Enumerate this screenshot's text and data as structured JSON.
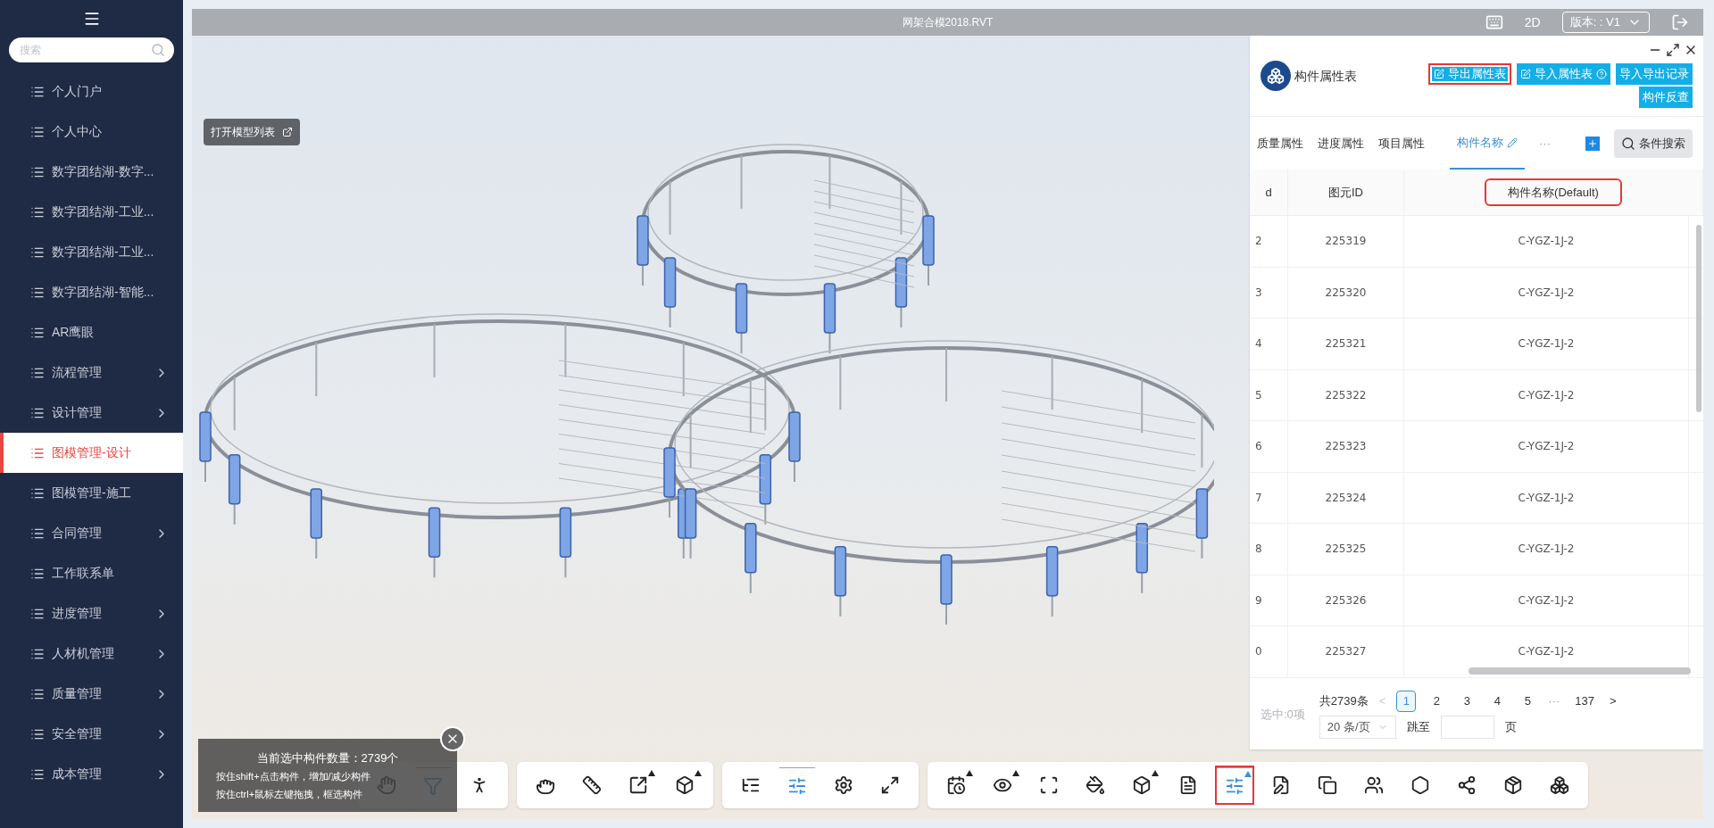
{
  "sidebar": {
    "search": {
      "placeholder": "搜索"
    },
    "items": [
      {
        "label": "个人门户",
        "selected": false,
        "expandable": false
      },
      {
        "label": "个人中心",
        "selected": false,
        "expandable": false
      },
      {
        "label": "数字团结湖-数字...",
        "selected": false,
        "expandable": false
      },
      {
        "label": "数字团结湖-工业...",
        "selected": false,
        "expandable": false
      },
      {
        "label": "数字团结湖-工业...",
        "selected": false,
        "expandable": false
      },
      {
        "label": "数字团结湖-智能...",
        "selected": false,
        "expandable": false
      },
      {
        "label": "AR鹰眼",
        "selected": false,
        "expandable": false
      },
      {
        "label": "流程管理",
        "selected": false,
        "expandable": true
      },
      {
        "label": "设计管理",
        "selected": false,
        "expandable": true
      },
      {
        "label": "图模管理-设计",
        "selected": true,
        "expandable": false
      },
      {
        "label": "图模管理-施工",
        "selected": false,
        "expandable": false
      },
      {
        "label": "合同管理",
        "selected": false,
        "expandable": true
      },
      {
        "label": "工作联系单",
        "selected": false,
        "expandable": false
      },
      {
        "label": "进度管理",
        "selected": false,
        "expandable": true
      },
      {
        "label": "人材机管理",
        "selected": false,
        "expandable": true
      },
      {
        "label": "质量管理",
        "selected": false,
        "expandable": true
      },
      {
        "label": "安全管理",
        "selected": false,
        "expandable": true
      },
      {
        "label": "成本管理",
        "selected": false,
        "expandable": true
      }
    ]
  },
  "viewer": {
    "title": "网架合模2018.RVT",
    "mode_button": "2D",
    "version_select": "版本: : V1",
    "open_model_list_button": "打开模型列表"
  },
  "panel": {
    "title": "构件属性表",
    "buttons": [
      {
        "label": "导出属性表",
        "marked": true,
        "help": false
      },
      {
        "label": "导入属性表",
        "marked": false,
        "help": true
      },
      {
        "label": "导入导出记录",
        "marked": false,
        "help": false
      },
      {
        "label": "构件反查",
        "marked": false,
        "help": false
      }
    ],
    "tabs": [
      {
        "label": "质量属性",
        "selected": false
      },
      {
        "label": "进度属性",
        "selected": false
      },
      {
        "label": "项目属性",
        "selected": false
      },
      {
        "label": "构件名称",
        "selected": true
      }
    ],
    "more": "···",
    "search_button": "条件搜索",
    "columns": [
      {
        "label": "d",
        "marked": false
      },
      {
        "label": "图元ID",
        "marked": false
      },
      {
        "label": "构件名称(Default)",
        "marked": true
      }
    ],
    "rows": [
      [
        "2",
        "225319",
        "C-YGZ-1J-2"
      ],
      [
        "3",
        "225320",
        "C-YGZ-1J-2"
      ],
      [
        "4",
        "225321",
        "C-YGZ-1J-2"
      ],
      [
        "5",
        "225322",
        "C-YGZ-1J-2"
      ],
      [
        "6",
        "225323",
        "C-YGZ-1J-2"
      ],
      [
        "7",
        "225324",
        "C-YGZ-1J-2"
      ],
      [
        "8",
        "225325",
        "C-YGZ-1J-2"
      ],
      [
        "9",
        "225326",
        "C-YGZ-1J-2"
      ],
      [
        "0",
        "225327",
        "C-YGZ-1J-2"
      ]
    ],
    "selected_count": "选中:0项",
    "total": "共2739条",
    "prev": {
      "label": "<",
      "disabled": true
    },
    "next": {
      "label": ">",
      "disabled": false
    },
    "pages": [
      {
        "label": "1",
        "kind": "page",
        "selected": true
      },
      {
        "label": "2",
        "kind": "page",
        "selected": false
      },
      {
        "label": "3",
        "kind": "page",
        "selected": false
      },
      {
        "label": "4",
        "kind": "page",
        "selected": false
      },
      {
        "label": "5",
        "kind": "page",
        "selected": false
      },
      {
        "label": "···",
        "kind": "ellipsis"
      },
      {
        "label": "137",
        "kind": "page",
        "selected": false
      }
    ],
    "page_size": "20 条/页",
    "jump_label": "跳至",
    "page_suffix": "页"
  },
  "selection_info": {
    "lines": [
      "当前选中构件数量：2739个",
      "按住shift+点击构件，增加/减少构件",
      "按住ctrl+鼠标左键拖拽，框选构件"
    ]
  },
  "toolbar_groups": [
    {
      "tools": [
        {
          "selected": false,
          "has_menu": false,
          "marked": false
        },
        {
          "selected": true,
          "has_menu": false,
          "marked": false
        },
        {
          "selected": false,
          "has_menu": false,
          "marked": false
        }
      ]
    },
    {
      "tools": [
        {
          "selected": false,
          "has_menu": false,
          "marked": false
        },
        {
          "selected": false,
          "has_menu": false,
          "marked": false
        },
        {
          "selected": false,
          "has_menu": true,
          "marked": false
        },
        {
          "selected": false,
          "has_menu": true,
          "marked": false
        }
      ]
    },
    {
      "tools": [
        {
          "selected": false,
          "has_menu": false,
          "marked": false
        },
        {
          "selected": true,
          "has_menu": false,
          "marked": false
        },
        {
          "selected": false,
          "has_menu": false,
          "marked": false
        },
        {
          "selected": false,
          "has_menu": false,
          "marked": false
        }
      ]
    },
    {
      "tools": [
        {
          "selected": false,
          "has_menu": true,
          "marked": false
        },
        {
          "selected": false,
          "has_menu": true,
          "marked": false
        },
        {
          "selected": false,
          "has_menu": false,
          "marked": false
        },
        {
          "selected": false,
          "has_menu": false,
          "marked": false
        },
        {
          "selected": false,
          "has_menu": true,
          "marked": false
        },
        {
          "selected": false,
          "has_menu": false,
          "marked": false
        },
        {
          "selected": true,
          "has_menu": true,
          "marked": true
        },
        {
          "selected": false,
          "has_menu": false,
          "marked": false
        },
        {
          "selected": false,
          "has_menu": false,
          "marked": false
        },
        {
          "selected": false,
          "has_menu": false,
          "marked": false
        },
        {
          "selected": false,
          "has_menu": false,
          "marked": false
        },
        {
          "selected": false,
          "has_menu": false,
          "marked": false
        },
        {
          "selected": false,
          "has_menu": false,
          "marked": false
        },
        {
          "selected": false,
          "has_menu": false,
          "marked": false
        }
      ]
    }
  ]
}
